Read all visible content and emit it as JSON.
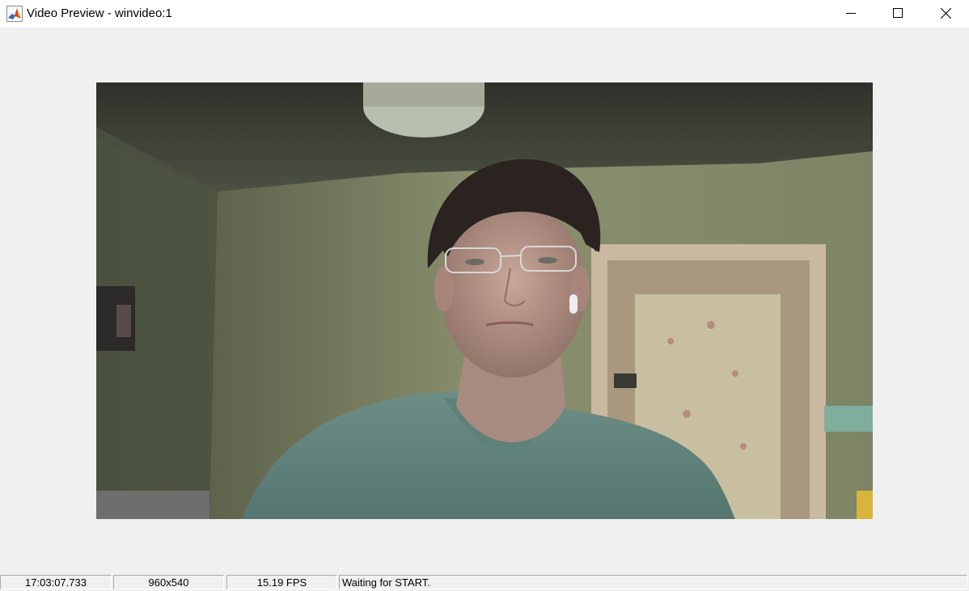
{
  "window": {
    "title": "Video Preview - winvideo:1",
    "icon": "matlab-icon",
    "controls": [
      "minimize-icon",
      "maximize-icon",
      "close-icon"
    ]
  },
  "preview": {
    "description_icon": "video-frame"
  },
  "status": {
    "timestamp": "17:03:07.733",
    "resolution": "960x540",
    "frame_rate": "15.19 FPS",
    "state": "Waiting for START."
  }
}
